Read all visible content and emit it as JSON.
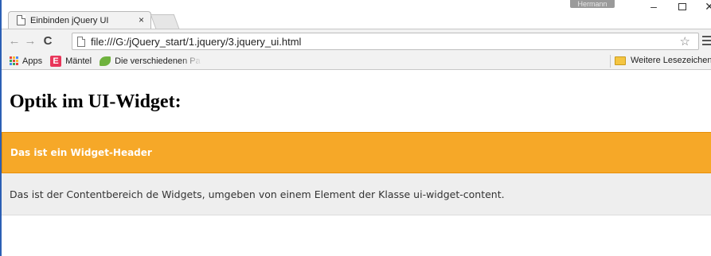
{
  "browser": {
    "tab_title": "Einbinden jQuery UI",
    "tab_close": "×",
    "user_badge": "Hermann",
    "url": "file:///G:/jQuery_start/1.jquery/3.jquery_ui.html",
    "window_min": "–",
    "window_close": "✕"
  },
  "nav": {
    "back": "←",
    "forward": "→",
    "reload": "C",
    "star": "☆"
  },
  "bookmarks": {
    "items": [
      {
        "label": "Apps",
        "icon": "apps-grid-icon"
      },
      {
        "label": "Mäntel",
        "icon": "e-brand-icon"
      },
      {
        "label": "Die verschiedenen Pa",
        "icon": "leaf-icon"
      }
    ],
    "other_label": "Weitere Lesezeichen"
  },
  "page": {
    "title": "Optik im UI-Widget:",
    "widget_header": "Das ist ein Widget-Header",
    "widget_content": "Das ist der Contentbereich de Widgets, umgeben von einem Element der Klasse ui-widget-content."
  },
  "colors": {
    "header_bg": "#f6a828",
    "content_bg": "#eeeeee",
    "window_border": "#2b5fb4"
  }
}
